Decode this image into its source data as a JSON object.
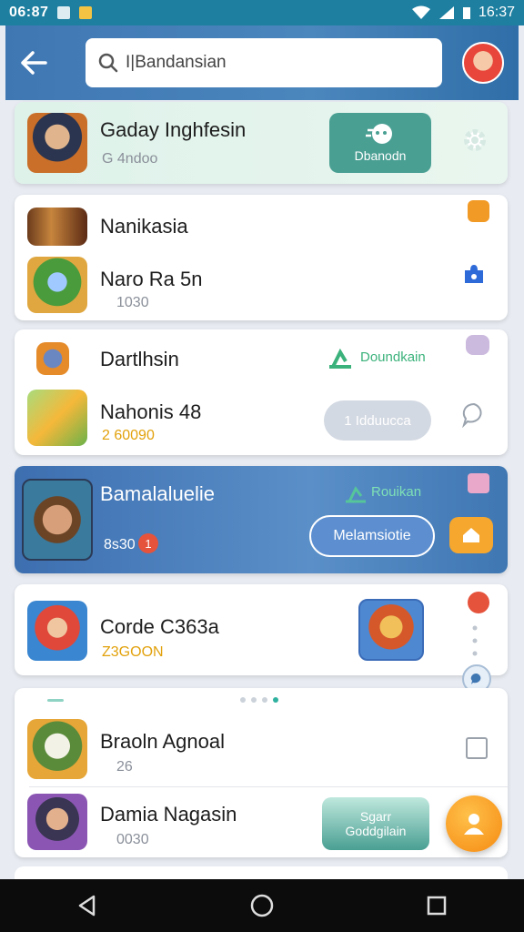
{
  "status": {
    "time": "06:87",
    "right_time": "16:37"
  },
  "search": {
    "placeholder": "I|Bandansian"
  },
  "cards": {
    "c1": {
      "name": "Gaday Inghfesin",
      "sub": "G 4ndoo",
      "button": "Dbanodn"
    },
    "c2": {
      "row1_name": "Nanikasia",
      "row2_name": "Naro Ra 5n",
      "row2_sub": "1030"
    },
    "c3": {
      "row1_name": "Dartlhsin",
      "row1_action": "Doundkain",
      "row2_name": "Nahonis 48",
      "row2_sub": "2 60090",
      "row2_button": "1 Idduucca"
    },
    "c4": {
      "name": "Bamalaluelie",
      "action": "Rouikan",
      "sub": "8s30",
      "badge": "1",
      "button": "Melamsiotie"
    },
    "c5": {
      "name": "Corde C363a",
      "sub": "Z3GOON"
    },
    "c6": {
      "row1_name": "Braoln Agnoal",
      "row1_sub": "26",
      "row2_name": "Damia Nagasin",
      "row2_sub": "0030",
      "row2_button_top": "Sgarr",
      "row2_button_bottom": "Goddgilain"
    }
  },
  "icon_names": [
    "back-arrow-icon",
    "search-icon",
    "gear-icon",
    "puzzle-icon",
    "leaf-icon",
    "chat-icon",
    "gift-icon",
    "home-icon",
    "more-vertical-icon",
    "checkbox-icon",
    "user-icon",
    "nav-back-icon",
    "nav-home-icon",
    "nav-recents-icon"
  ],
  "colors": {
    "header": "#3f77b3",
    "accent_green": "#3bb27b",
    "gold": "#e2a10b",
    "orange": "#f59a1a"
  }
}
